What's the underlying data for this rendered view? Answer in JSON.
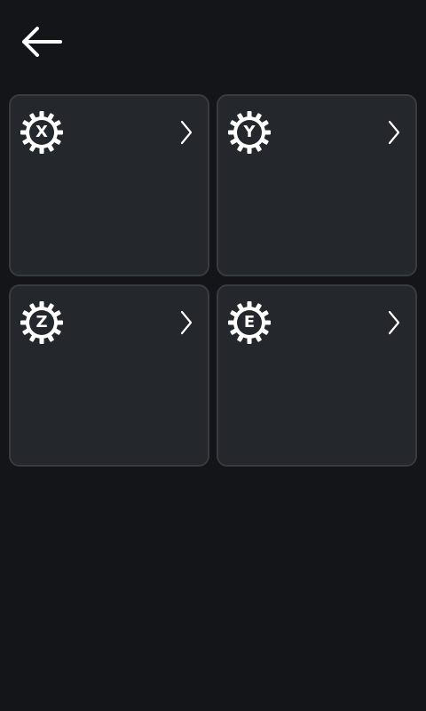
{
  "header": {
    "back_icon": "arrow-left-icon"
  },
  "cards": [
    {
      "letter": "X",
      "icon": "gear-icon",
      "chevron": "chevron-right-icon"
    },
    {
      "letter": "Y",
      "icon": "gear-icon",
      "chevron": "chevron-right-icon"
    },
    {
      "letter": "Z",
      "icon": "gear-icon",
      "chevron": "chevron-right-icon"
    },
    {
      "letter": "E",
      "icon": "gear-icon",
      "chevron": "chevron-right-icon"
    }
  ],
  "colors": {
    "background": "#131518",
    "card": "#24272c",
    "card_border": "#383b40",
    "foreground": "#ffffff"
  }
}
